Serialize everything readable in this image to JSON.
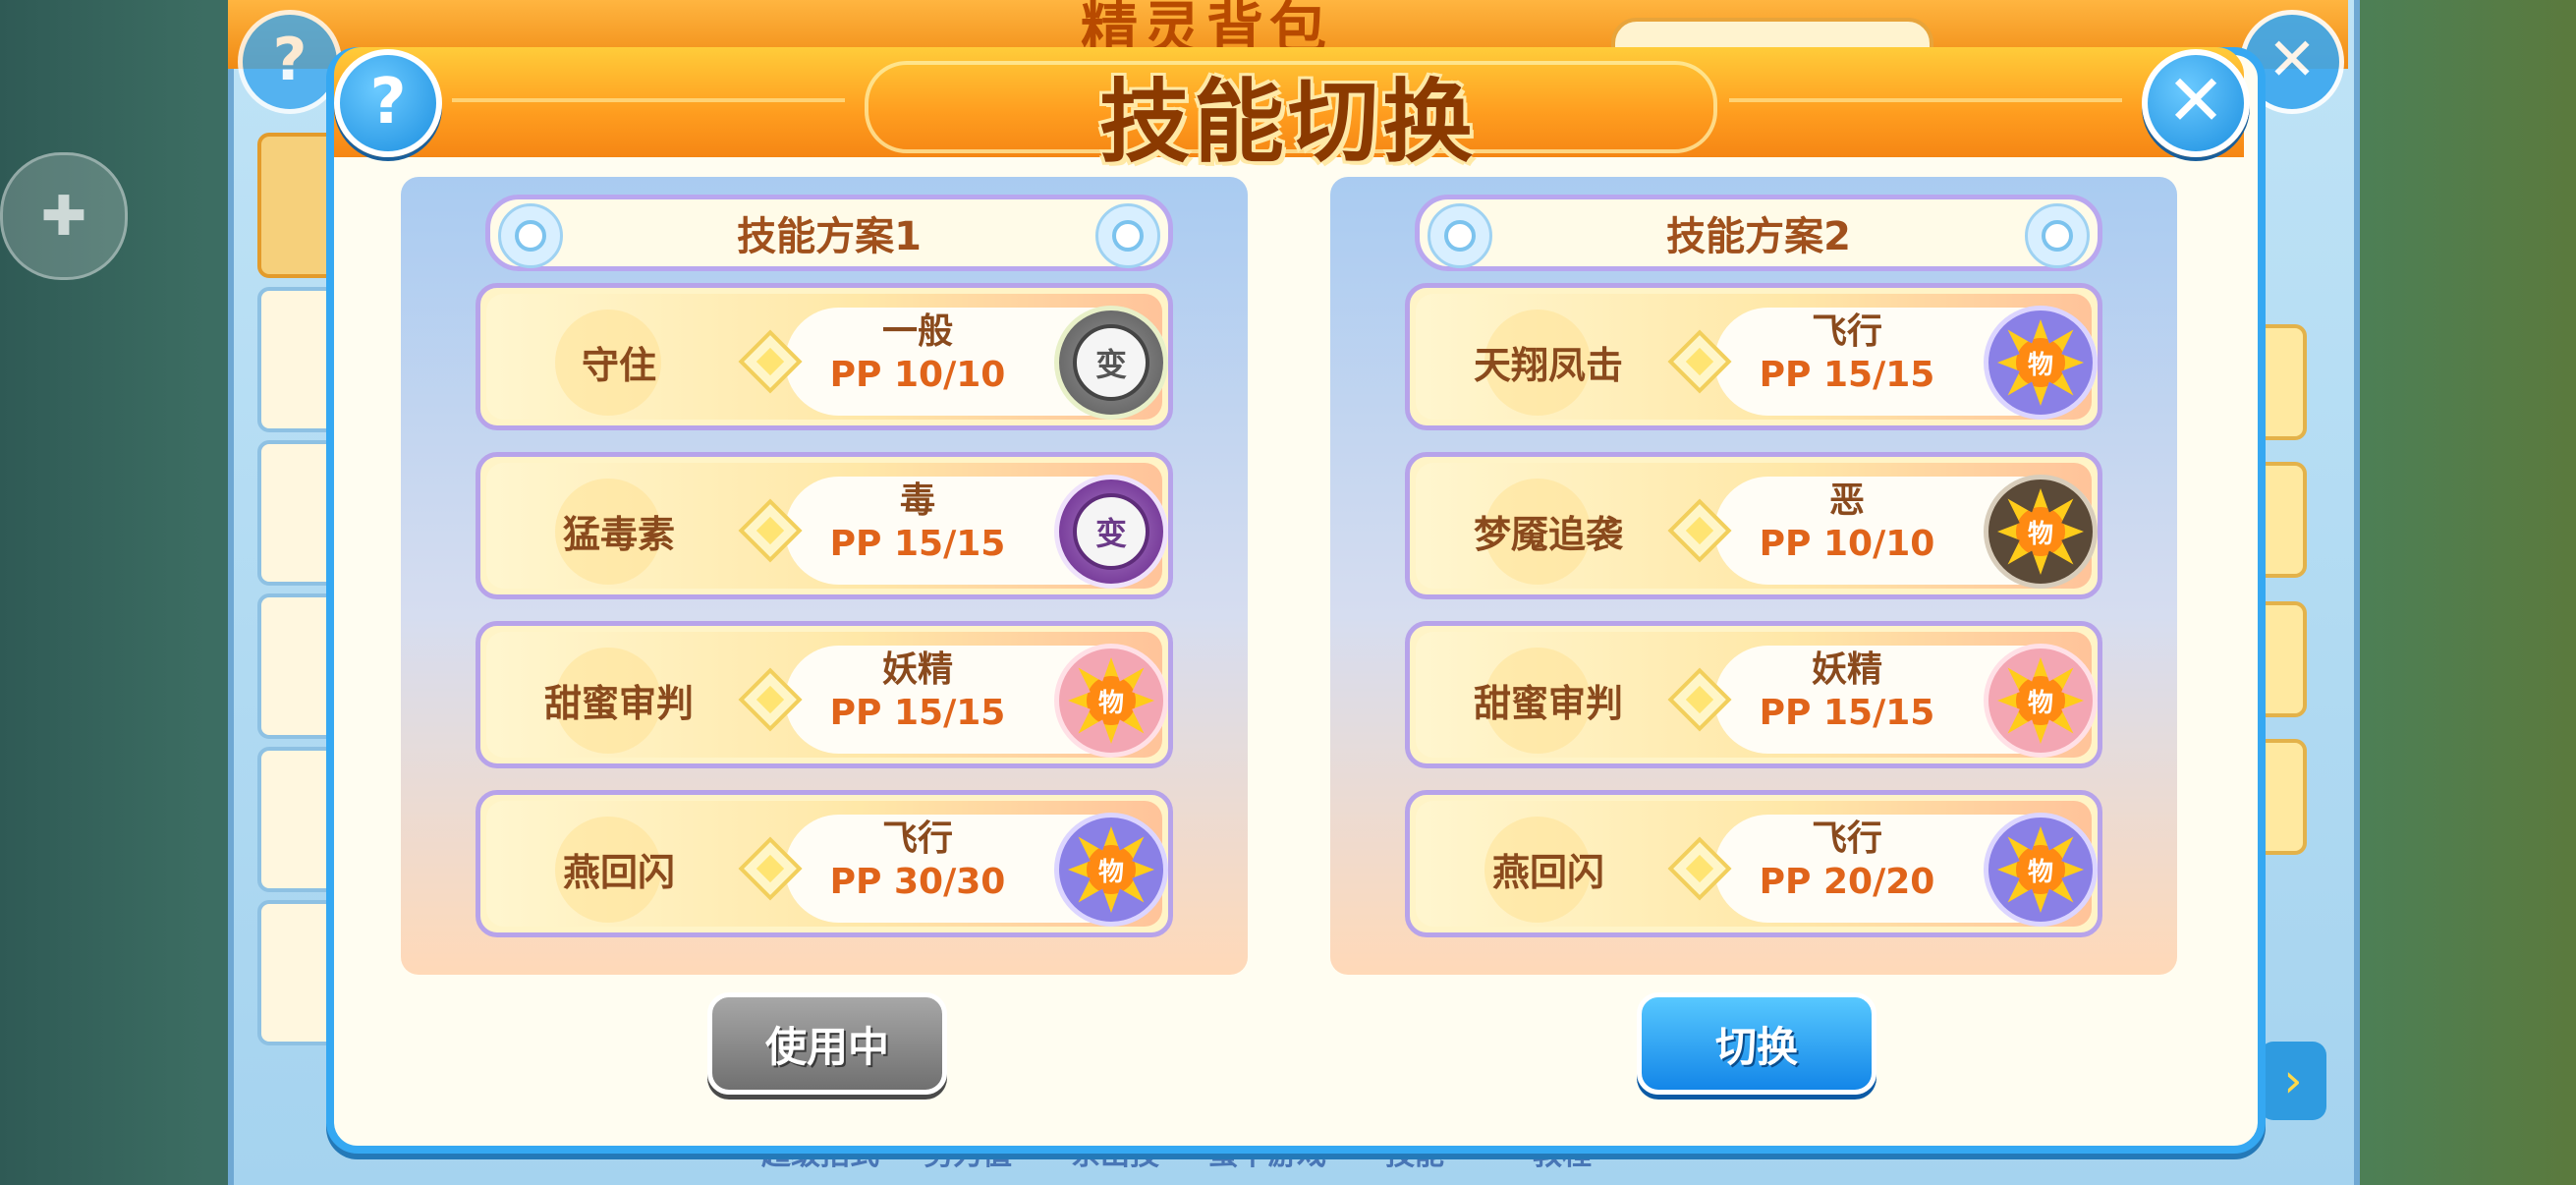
{
  "background": {
    "title": "精灵背包",
    "bottom_labels": [
      "超级招式",
      "努力值",
      "系出技",
      "蛋中游戏",
      "技能",
      "教程"
    ]
  },
  "dialog": {
    "title": "技能切换",
    "help_icon": "?",
    "close_icon": "✕"
  },
  "plans": [
    {
      "title": "技能方案1",
      "skills": [
        {
          "name": "守住",
          "type": "一般",
          "pp": "PP 10/10",
          "badge": "变",
          "badge_kind": "status"
        },
        {
          "name": "猛毒素",
          "type": "毒",
          "pp": "PP 15/15",
          "badge": "变",
          "badge_kind": "status-poison"
        },
        {
          "name": "甜蜜审判",
          "type": "妖精",
          "pp": "PP 15/15",
          "badge": "物",
          "badge_kind": "phys-fairy"
        },
        {
          "name": "燕回闪",
          "type": "飞行",
          "pp": "PP 30/30",
          "badge": "物",
          "badge_kind": "phys-fly"
        }
      ],
      "button": "使用中"
    },
    {
      "title": "技能方案2",
      "skills": [
        {
          "name": "天翔凤击",
          "type": "飞行",
          "pp": "PP 15/15",
          "badge": "物",
          "badge_kind": "phys-fly"
        },
        {
          "name": "梦魇追袭",
          "type": "恶",
          "pp": "PP 10/10",
          "badge": "物",
          "badge_kind": "phys-dark"
        },
        {
          "name": "甜蜜审判",
          "type": "妖精",
          "pp": "PP 15/15",
          "badge": "物",
          "badge_kind": "phys-fairy"
        },
        {
          "name": "燕回闪",
          "type": "飞行",
          "pp": "PP 20/20",
          "badge": "物",
          "badge_kind": "phys-fly"
        }
      ],
      "button": "切换"
    }
  ],
  "colors": {
    "dialog_border": "#35a8f2",
    "header_orange": "#ff9d1f",
    "title_brown": "#8b3a00",
    "pp_orange": "#e0641a",
    "active_button": "#1386e8",
    "inactive_button": "#707070"
  },
  "icons": {
    "gamepad": "gamepad-icon",
    "help": "help-icon",
    "close": "close-icon",
    "skill_slot": "diamond-icon",
    "plan_decor": "triangle-emblem-icon"
  }
}
